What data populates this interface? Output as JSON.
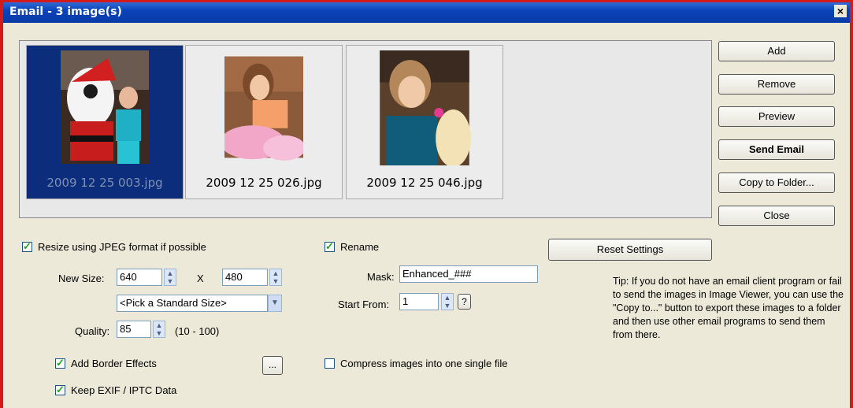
{
  "window": {
    "title": "Email  -  3 image(s)",
    "close_glyph": "×"
  },
  "gallery": {
    "images": [
      {
        "filename": "2009 12 25 003.jpg",
        "selected": true
      },
      {
        "filename": "2009 12 25 026.jpg",
        "selected": false
      },
      {
        "filename": "2009 12 25 046.jpg",
        "selected": false
      }
    ]
  },
  "buttons": {
    "add": "Add",
    "remove": "Remove",
    "preview": "Preview",
    "send_email": "Send Email",
    "copy_to_folder": "Copy to Folder...",
    "close": "Close",
    "reset_settings": "Reset Settings",
    "border_more": "...",
    "start_help": "?"
  },
  "resize": {
    "checked": true,
    "label": "Resize using JPEG format if possible",
    "new_size_label": "New Size:",
    "width": "640",
    "x_label": "X",
    "height": "480",
    "standard_size": "<Pick a Standard Size>",
    "quality_label": "Quality:",
    "quality": "85",
    "quality_range": "(10 - 100)"
  },
  "options": {
    "border_label": "Add Border Effects",
    "border_checked": true,
    "exif_label": "Keep EXIF / IPTC Data",
    "exif_checked": true,
    "compress_label": "Compress images into one single file",
    "compress_checked": false
  },
  "rename": {
    "checked": true,
    "label": "Rename",
    "mask_label": "Mask:",
    "mask": "Enhanced_###",
    "start_label": "Start From:",
    "start": "1"
  },
  "tip": "Tip: If you do not have an email client program or fail to send the images in Image Viewer, you can use the \"Copy to...\" button to export these images to a folder and then use other email programs to send them from there.",
  "colors": {
    "titlebar": "#0a43b8",
    "selection": "#0b2d7c",
    "frame": "#d41b1b"
  }
}
